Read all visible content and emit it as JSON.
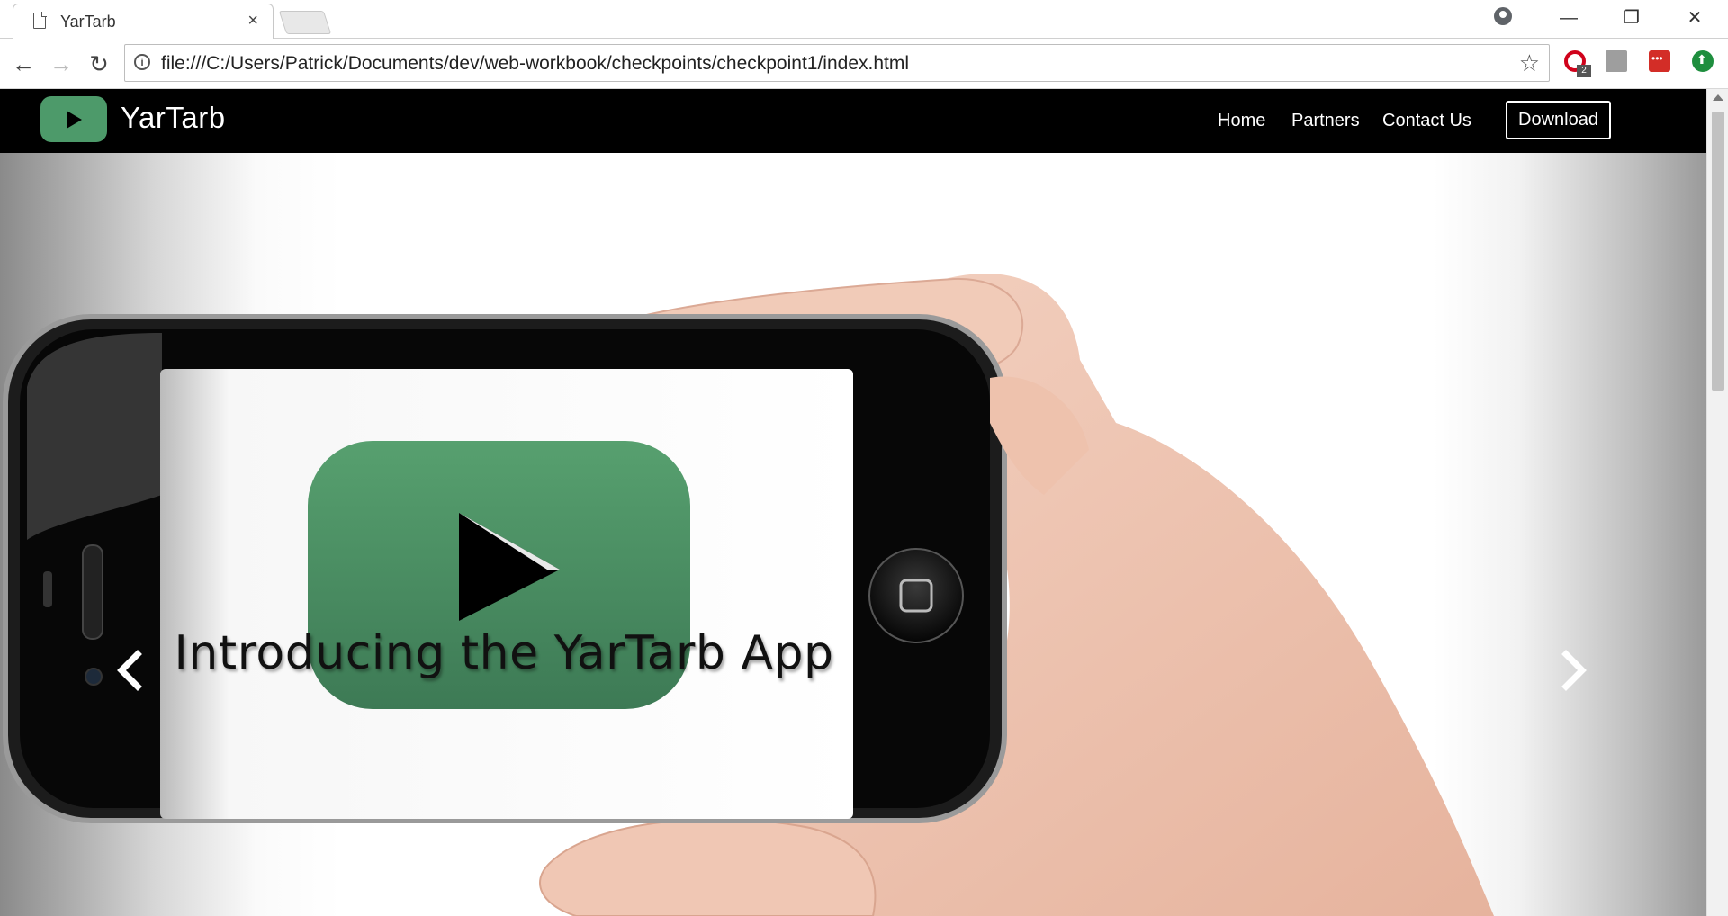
{
  "browser": {
    "tab_title": "YarTarb",
    "tab_close": "×",
    "url": "file:///C:/Users/Patrick/Documents/dev/web-workbook/checkpoints/checkpoint1/index.html",
    "minimize": "—",
    "restore": "❐",
    "close": "✕",
    "back": "←",
    "forward": "→",
    "reload": "↻",
    "star": "☆",
    "info": "i",
    "opera_badge": "2"
  },
  "site": {
    "brand": "YarTarb",
    "nav": {
      "home": "Home",
      "partners": "Partners",
      "contact": "Contact Us",
      "download": "Download"
    },
    "hero": {
      "caption": "Introducing the YarTarb App",
      "prev": "‹",
      "next": "›"
    }
  },
  "colors": {
    "navbar_bg": "#000000",
    "brand_green": "#4d9a6a",
    "logo_green_light": "#57a06f",
    "logo_green_dark": "#3d7a55"
  }
}
